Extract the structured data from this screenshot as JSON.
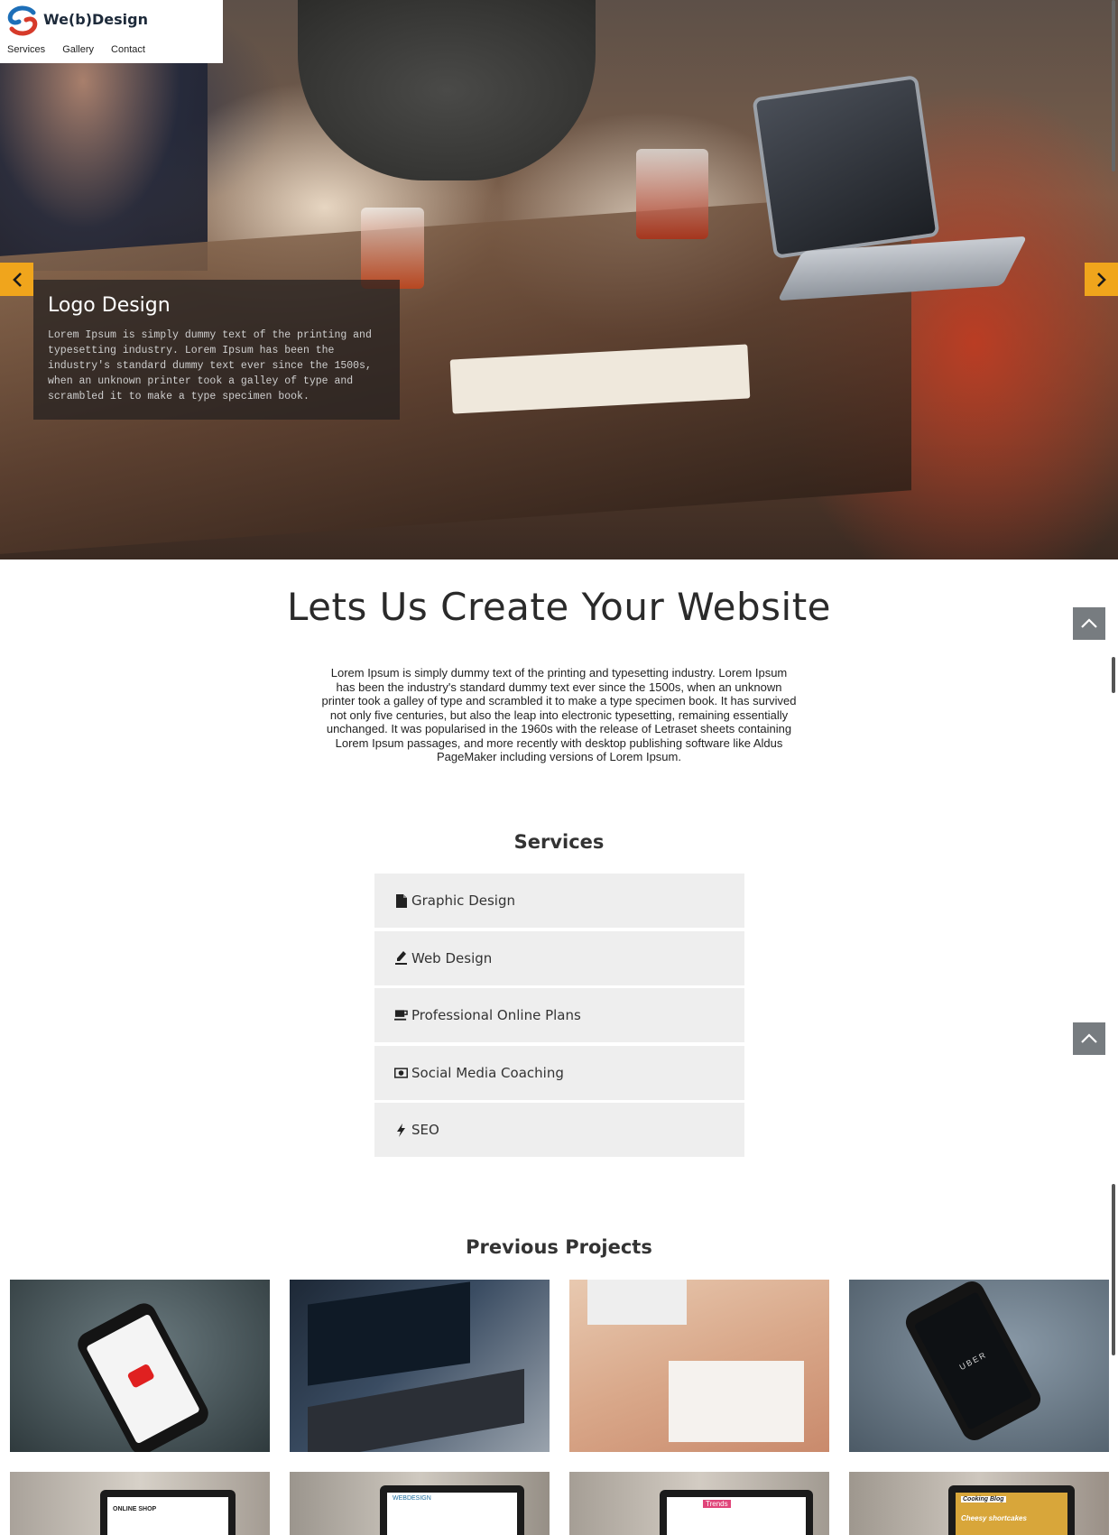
{
  "brand": {
    "name": "We(b)Design",
    "logo_icon": "swirl-logo-icon",
    "colors": {
      "blue": "#1d6fb8",
      "red": "#d63a2a"
    }
  },
  "nav": {
    "items": [
      "Services",
      "Gallery",
      "Contact"
    ]
  },
  "slider": {
    "prev_icon": "chevron-left-icon",
    "next_icon": "chevron-right-icon",
    "caption_title": "Logo Design",
    "caption_text": "Lorem Ipsum is simply dummy text of the printing and typesetting industry. Lorem Ipsum has been the industry's standard dummy text ever since the 1500s, when an unknown printer took a galley of type and scrambled it to make a type specimen book.",
    "accent_color": "#f0a51c"
  },
  "intro": {
    "headline": "Lets Us Create Your Website",
    "body": "Lorem Ipsum is simply dummy text of the printing and typesetting industry. Lorem Ipsum has been the industry's standard dummy text ever since the 1500s, when an unknown printer took a galley of type and scrambled it to make a type specimen book. It has survived not only five centuries, but also the leap into electronic typesetting, remaining essentially unchanged. It was popularised in the 1960s with the release of Letraset sheets containing Lorem Ipsum passages, and more recently with desktop publishing software like Aldus PageMaker including versions of Lorem Ipsum."
  },
  "back_to_top_icon": "chevron-up-icon",
  "services": {
    "title": "Services",
    "items": [
      {
        "label": "Graphic Design",
        "icon": "file-icon"
      },
      {
        "label": "Web Design",
        "icon": "pen-icon"
      },
      {
        "label": "Professional Online Plans",
        "icon": "cup-icon"
      },
      {
        "label": "Social Media Coaching",
        "icon": "money-icon"
      },
      {
        "label": "SEO",
        "icon": "bolt-icon"
      }
    ]
  },
  "projects": {
    "title": "Previous Projects",
    "screen_texts": [
      "UBER",
      "WEBDESIGN",
      "ONLINE SHOP",
      "Trends",
      "Cooking Blog",
      "Cheesy shortcakes"
    ]
  }
}
